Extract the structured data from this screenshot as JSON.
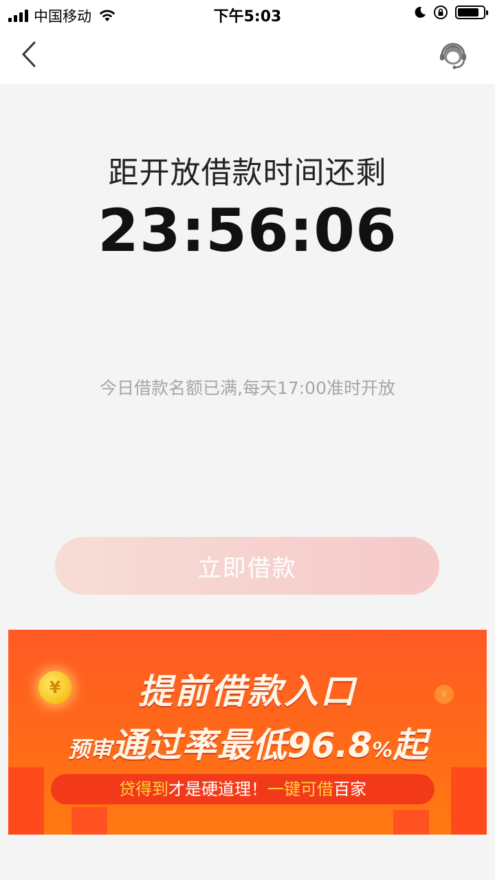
{
  "status_bar": {
    "carrier": "中国移动",
    "time": "下午5:03"
  },
  "nav": {
    "back_icon": "chevron-left-icon",
    "service_icon": "customer-service-headset-icon"
  },
  "countdown": {
    "label": "距开放借款时间还剩",
    "time": "23:56:06"
  },
  "notice": "今日借款名额已满,每天17:00准时开放",
  "borrow_button": "立即借款",
  "banner": {
    "title": "提前借款入口",
    "sub_prefix": "预审",
    "sub_main": "通过率最低",
    "sub_number": "96.8",
    "sub_percent": "%",
    "sub_suffix": "起",
    "slogan_part1": "贷得到",
    "slogan_part2": "才是硬道理！",
    "slogan_part3": "一键可借",
    "slogan_part4": "百家",
    "coin_symbol": "¥",
    "colors": {
      "background": "#ff5a24",
      "slogan_highlight": "#ffd23c"
    }
  }
}
